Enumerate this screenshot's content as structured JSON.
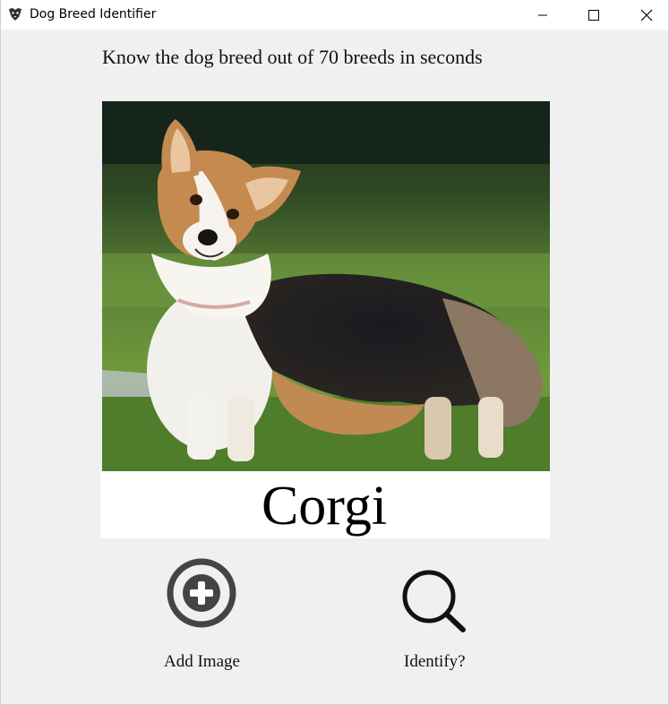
{
  "window": {
    "title": "Dog Breed Identifier"
  },
  "main": {
    "tagline": "Know the dog breed out of 70 breeds in seconds",
    "image_subject": "corgi-dog-photo",
    "result_text": "Corgi"
  },
  "buttons": {
    "add_image_label": "Add Image",
    "add_image_icon": "plus-circle-icon",
    "identify_label": "Identify?",
    "identify_icon": "magnifier-icon"
  },
  "colors": {
    "background": "#f0f0f0",
    "icon_gray": "#444444",
    "icon_black": "#111111"
  }
}
